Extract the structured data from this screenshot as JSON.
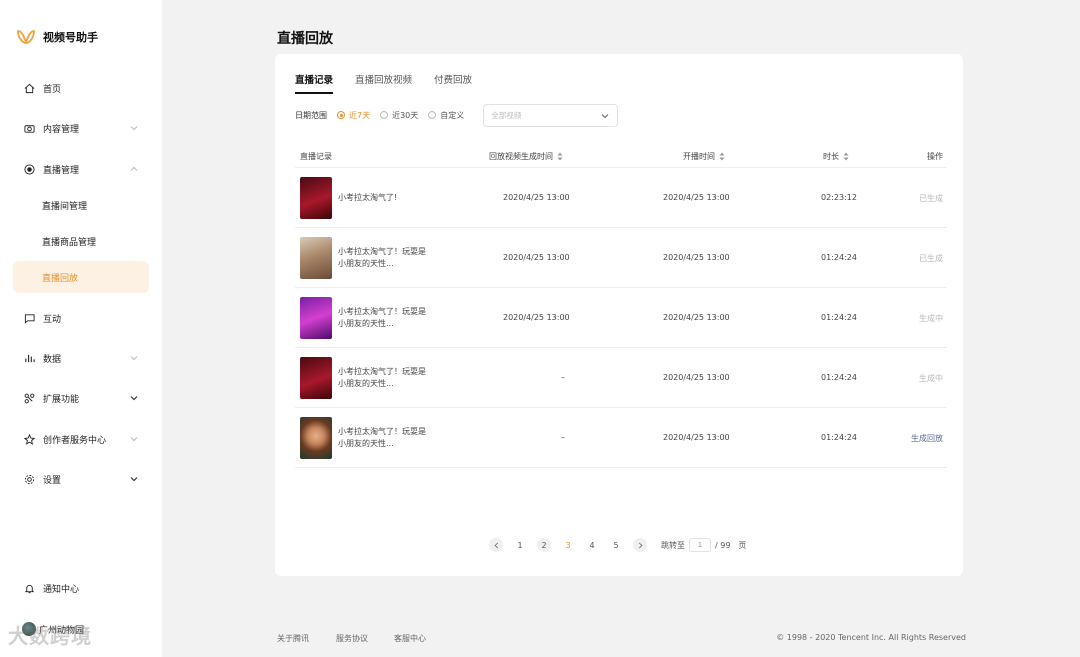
{
  "app": {
    "name": "视频号助手",
    "brand_color": "#e8902b"
  },
  "sidebar": {
    "items": [
      {
        "label": "首页",
        "icon": "home-icon"
      },
      {
        "label": "内容管理",
        "icon": "camera-icon"
      },
      {
        "label": "直播管理",
        "icon": "live-icon"
      },
      {
        "label": "直播间管理"
      },
      {
        "label": "直播商品管理"
      },
      {
        "label": "直播回放"
      },
      {
        "label": "互动",
        "icon": "comment-icon"
      },
      {
        "label": "数据",
        "icon": "bar-chart-icon"
      },
      {
        "label": "扩展功能",
        "icon": "extension-icon"
      },
      {
        "label": "创作者服务中心",
        "icon": "star-icon"
      },
      {
        "label": "设置",
        "icon": "gear-icon"
      }
    ],
    "notify": "通知中心",
    "user": "广州动物园",
    "watermark": "大数跨境"
  },
  "page": {
    "title": "直播回放"
  },
  "tabs": [
    "直播记录",
    "直播回放视频",
    "付费回放"
  ],
  "filters": {
    "label": "日期范围",
    "options": [
      "近7天",
      "近30天",
      "自定义"
    ],
    "selected": "近7天",
    "select_placeholder": "全部视频"
  },
  "table": {
    "headers": [
      "直播记录",
      "回放视频生成时间",
      "开播时间",
      "时长",
      "操作"
    ],
    "rows": [
      {
        "title": "小考拉太淘气了!",
        "gen_time": "2020/4/25 13:00",
        "start_time": "2020/4/25 13:00",
        "duration": "02:23:12",
        "action": "已生成"
      },
      {
        "title": "小考拉太淘气了！玩耍是小朋友的天性...",
        "gen_time": "2020/4/25 13:00",
        "start_time": "2020/4/25 13:00",
        "duration": "01:24:24",
        "action": "已生成"
      },
      {
        "title": "小考拉太淘气了！玩耍是小朋友的天性...",
        "gen_time": "2020/4/25 13:00",
        "start_time": "2020/4/25 13:00",
        "duration": "01:24:24",
        "action": "生成中"
      },
      {
        "title": "小考拉太淘气了！玩耍是小朋友的天性...",
        "gen_time": "–",
        "start_time": "2020/4/25 13:00",
        "duration": "01:24:24",
        "action": "生成中"
      },
      {
        "title": "小考拉太淘气了！玩耍是小朋友的天性...",
        "gen_time": "–",
        "start_time": "2020/4/25 13:00",
        "duration": "01:24:24",
        "action": "生成回放"
      }
    ]
  },
  "pagination": {
    "pages": [
      "1",
      "2",
      "3",
      "4",
      "5"
    ],
    "current": "3",
    "jump_label": "跳转至",
    "jump_value": "1",
    "total": "/ 99",
    "unit": "页"
  },
  "footer": {
    "links": [
      "关于腾讯",
      "服务协议",
      "客服中心"
    ],
    "copyright": "© 1998 - 2020 Tencent Inc. All Rights Reserved"
  }
}
